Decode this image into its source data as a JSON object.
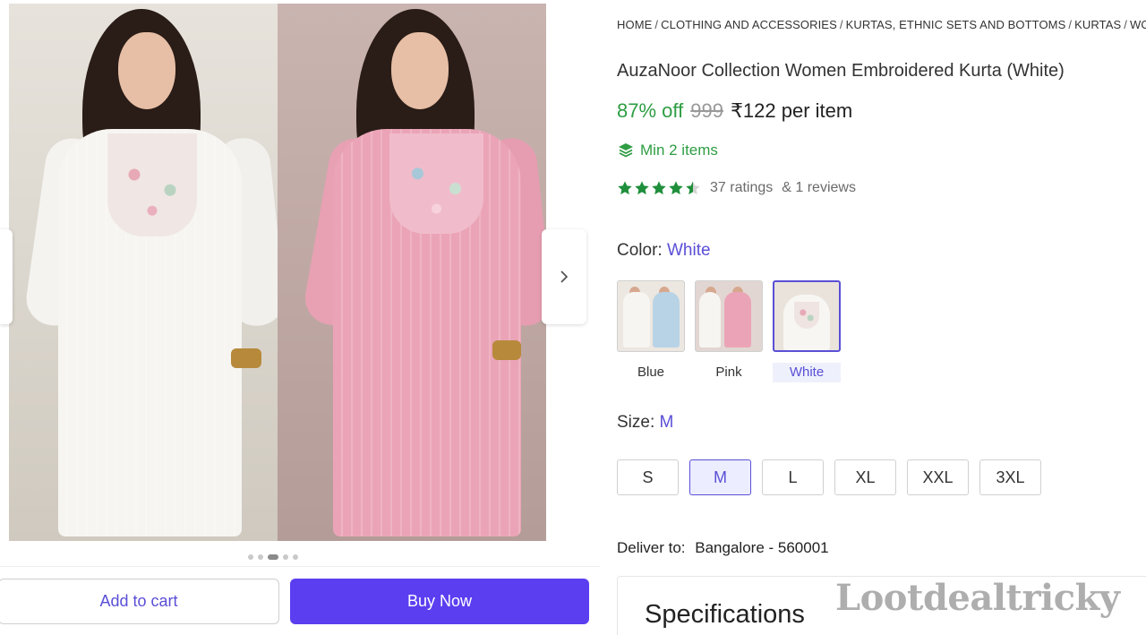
{
  "gallery": {
    "nav_next_icon": "chevron-right-icon",
    "dots_total": 5,
    "dots_active": 3
  },
  "actions": {
    "add_to_cart": "Add to cart",
    "buy_now": "Buy Now"
  },
  "breadcrumb": [
    "HOME",
    "CLOTHING AND ACCESSORIES",
    "KURTAS, ETHNIC SETS AND BOTTOMS",
    "KURTAS",
    "WOMEN"
  ],
  "product": {
    "title": "AuzaNoor Collection Women Embroidered Kurta (White)",
    "discount": "87% off",
    "mrp": "999",
    "price": "₹122 per item",
    "min_items": "Min 2 items",
    "rating_value": 4.5,
    "ratings_text": "37 ratings",
    "reviews_text": "& 1 reviews"
  },
  "color": {
    "label": "Color:",
    "selected": "White",
    "options": [
      "Blue",
      "Pink",
      "White"
    ]
  },
  "size": {
    "label": "Size:",
    "selected": "M",
    "options": [
      "S",
      "M",
      "L",
      "XL",
      "XXL",
      "3XL"
    ]
  },
  "delivery": {
    "label": "Deliver to:",
    "location": "Bangalore - 560001"
  },
  "specifications": {
    "title": "Specifications"
  },
  "watermark": "Lootdealtricky",
  "colors": {
    "accent": "#5a4fd6",
    "buy_button": "#5b3ef0",
    "green": "#2e9d43"
  }
}
